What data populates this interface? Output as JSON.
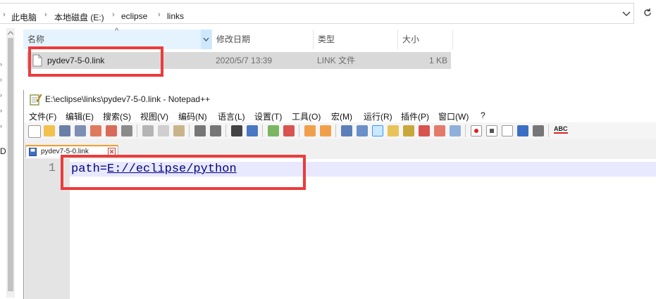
{
  "explorer": {
    "breadcrumb": [
      "此电脑",
      "本地磁盘 (E:)",
      "eclipse",
      "links"
    ],
    "columns": [
      "名称",
      "修改日期",
      "类型",
      "大小"
    ],
    "sort_glyph": "^",
    "files": [
      {
        "name": "pydev7-5-0.link",
        "modified": "2020/5/7 13:39",
        "type": "LINK 文件",
        "size": "1 KB"
      }
    ],
    "side_letter": "D"
  },
  "notepadpp": {
    "title": "E:\\eclipse\\links\\pydev7-5-0.link - Notepad++",
    "menu": [
      "文件(F)",
      "编辑(E)",
      "搜索(S)",
      "视图(V)",
      "编码(N)",
      "语言(L)",
      "设置(T)",
      "工具(O)",
      "宏(M)",
      "运行(R)",
      "插件(P)",
      "窗口(W)",
      "?"
    ],
    "tab_label": "pydev7-5-0.link",
    "line_number": "1",
    "code_key": "path=",
    "code_value": "E://eclipse/python",
    "toolbar_spell": "ABC"
  },
  "colors": {
    "highlight_red": "#ec3b3b",
    "selection_gray": "#d9d9d9",
    "current_line": "#e8e8ff",
    "tab_accent": "#fa9a28"
  }
}
